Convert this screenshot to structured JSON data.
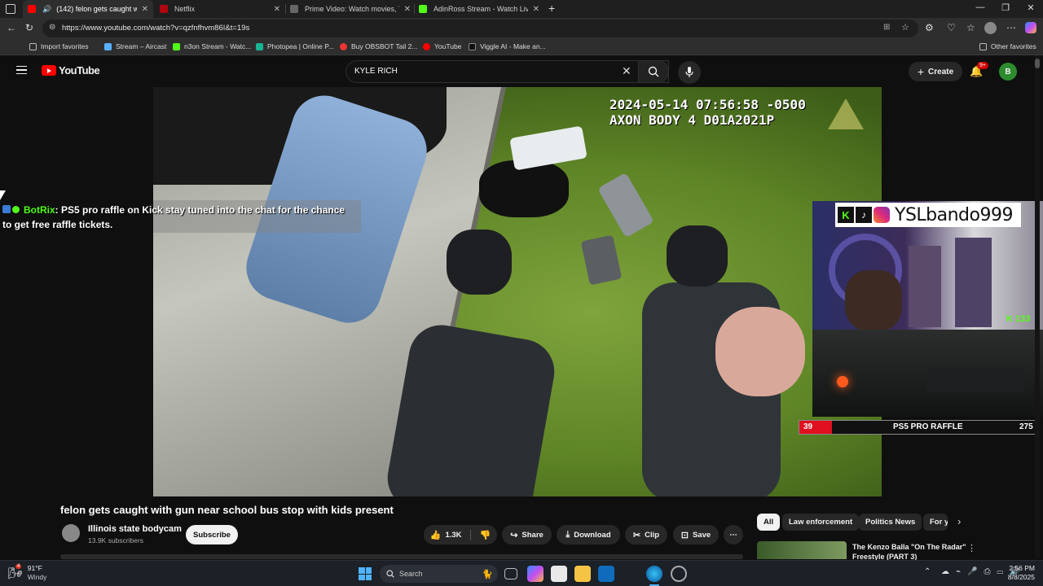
{
  "browser": {
    "tabs": [
      {
        "title": "(142) felon gets caught wit",
        "active": true
      },
      {
        "title": "Netflix",
        "active": false
      },
      {
        "title": "Prime Video: Watch movies, TV sh",
        "active": false
      },
      {
        "title": "AdinRoss Stream - Watch Live on",
        "active": false
      }
    ],
    "url": "https://www.youtube.com/watch?v=qzfnfhvm86I&t=19s",
    "bookmarks": [
      "Import favorites",
      "Stream – Aircast",
      "n3on Stream - Watc...",
      "Photopea | Online P...",
      "Buy OBSBOT Tail 2...",
      "YouTube",
      "Viggle AI - Make an..."
    ],
    "other_favorites": "Other favorites"
  },
  "youtube": {
    "logo_text": "YouTube",
    "search_value": "KYLE RICH",
    "create_label": "Create",
    "notification_count": "9+",
    "avatar_letter": "B"
  },
  "video": {
    "bodycam_timestamp": "2024-05-14 07:56:58 -0500",
    "bodycam_device": "AXON BODY 4 D01A2021P",
    "title": "felon gets caught with gun near school bus stop with kids present",
    "channel_name": "Illinois state bodycam",
    "subscribers": "13.9K subscribers",
    "subscribe_label": "Subscribe",
    "like_count": "1.3K",
    "share_label": "Share",
    "download_label": "Download",
    "clip_label": "Clip",
    "save_label": "Save"
  },
  "overlay": {
    "chat_user": "BotRix",
    "chat_message": ": PS5 pro raffle on Kick stay tuned into the chat for the chance to get free raffle tickets.",
    "streamer_handle": "YSLbando999",
    "viewer_count": "133",
    "raffle_left": "39",
    "raffle_label": "PS5 PRO RAFFLE",
    "raffle_right": "275"
  },
  "sidebar": {
    "chips": [
      "All",
      "Law enforcement",
      "Politics News",
      "For y"
    ],
    "rec_title_line1": "The Kenzo Balla \"On The Radar\"",
    "rec_title_line2": "Freestyle (PART 3)"
  },
  "taskbar": {
    "temperature": "91°F",
    "weather": "Windy",
    "search_placeholder": "Search",
    "time": "2:56 PM",
    "date": "8/8/2025",
    "weather_badge": "4"
  },
  "colors": {
    "yt_red": "#ff0000",
    "kick_green": "#53fc18",
    "accent_blue": "#3ea6ff"
  }
}
